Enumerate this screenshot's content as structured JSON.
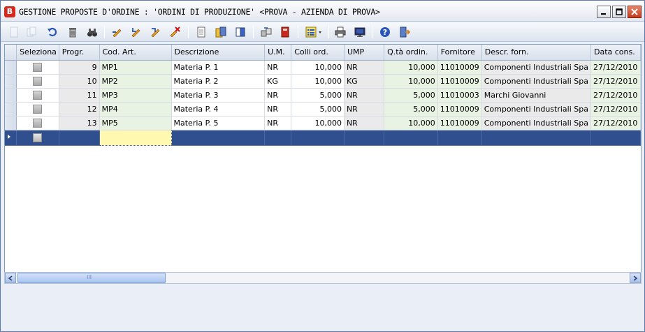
{
  "window": {
    "title": "GESTIONE PROPOSTE D'ORDINE :  'ORDINI DI PRODUZIONE' <PROVA - AZIENDA DI PROVA>",
    "app_icon_letter": "B"
  },
  "toolbar": {
    "icons": [
      "new-document-icon",
      "copy-icon",
      "undo-icon",
      "delete-icon",
      "find-binoculars-icon",
      "edit-pencil-1-icon",
      "edit-pencil-2-icon",
      "edit-pencil-3-icon",
      "edit-cancel-icon",
      "page-icon",
      "folder-book-icon",
      "book-icon",
      "transfer-icon",
      "red-book-icon",
      "list-view-icon",
      "print-icon",
      "monitor-icon",
      "help-icon",
      "exit-door-icon"
    ]
  },
  "grid": {
    "columns": [
      "Seleziona",
      "Progr.",
      "Cod. Art.",
      "Descrizione",
      "U.M.",
      "Colli ord.",
      "UMP",
      "Q.tà ordin.",
      "Fornitore",
      "Descr. forn.",
      "Data cons."
    ],
    "rows": [
      {
        "progr": "9",
        "cod": "MP1",
        "descr": "Materia P. 1",
        "um": "NR",
        "colli": "10,000",
        "ump": "NR",
        "qta": "10,000",
        "forn": "11010009",
        "descr_forn": "Componenti Industriali Spa",
        "data": "27/12/2010"
      },
      {
        "progr": "10",
        "cod": "MP2",
        "descr": "Materia P. 2",
        "um": "KG",
        "colli": "10,000",
        "ump": "KG",
        "qta": "10,000",
        "forn": "11010009",
        "descr_forn": "Componenti Industriali Spa",
        "data": "27/12/2010"
      },
      {
        "progr": "11",
        "cod": "MP3",
        "descr": "Materia P. 3",
        "um": "NR",
        "colli": "5,000",
        "ump": "NR",
        "qta": "5,000",
        "forn": "11010003",
        "descr_forn": "Marchi Giovanni",
        "data": "27/12/2010"
      },
      {
        "progr": "12",
        "cod": "MP4",
        "descr": "Materia P. 4",
        "um": "NR",
        "colli": "5,000",
        "ump": "NR",
        "qta": "5,000",
        "forn": "11010009",
        "descr_forn": "Componenti Industriali Spa",
        "data": "27/12/2010"
      },
      {
        "progr": "13",
        "cod": "MP5",
        "descr": "Materia P. 5",
        "um": "NR",
        "colli": "10,000",
        "ump": "NR",
        "qta": "10,000",
        "forn": "11010009",
        "descr_forn": "Componenti Industriali Spa",
        "data": "27/12/2010"
      }
    ]
  },
  "scrollbar": {
    "grip_label": "III"
  },
  "colors": {
    "selected_row": "#2f4f8f",
    "focused_cell": "#fff8b0",
    "readonly_cell": "#eaeaea",
    "editable_cell": "#e9f3e4"
  }
}
